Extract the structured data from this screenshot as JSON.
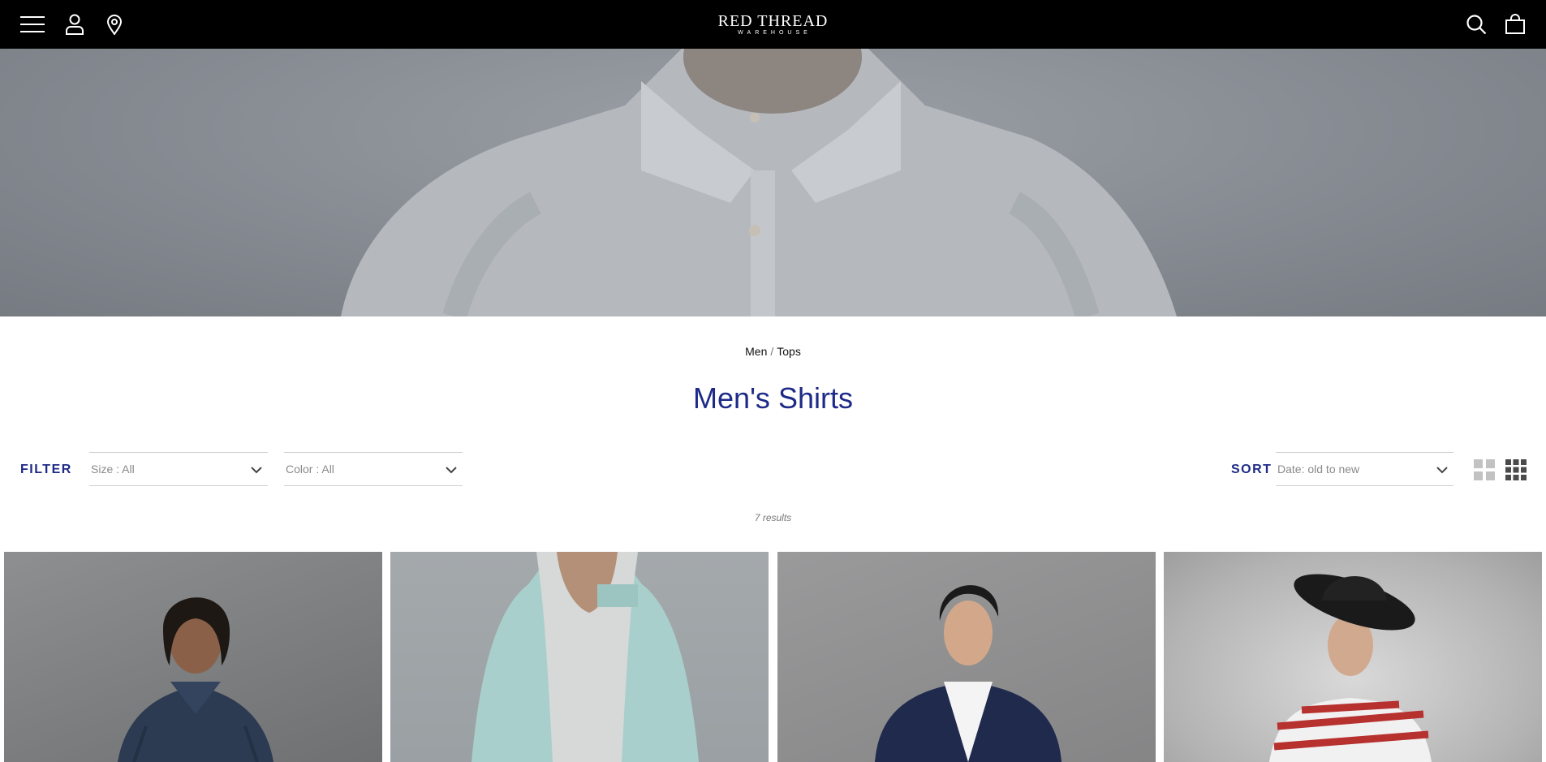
{
  "header": {
    "logo_main": "RED THREAD",
    "logo_sub": "WAREHOUSE",
    "icons": [
      "menu-icon",
      "account-icon",
      "location-pin-icon",
      "search-icon",
      "shopping-bag-icon"
    ]
  },
  "breadcrumb": {
    "items": [
      "Men",
      "Tops"
    ],
    "separator": "/"
  },
  "page": {
    "title": "Men's Shirts"
  },
  "filters": {
    "label": "FILTER",
    "size": "Size : All",
    "color": "Color : All"
  },
  "sort": {
    "label": "SORT",
    "value": "Date: old to new"
  },
  "results": "7 results",
  "colors": {
    "header_bg": "#000000",
    "accent": "#1d2a87"
  }
}
